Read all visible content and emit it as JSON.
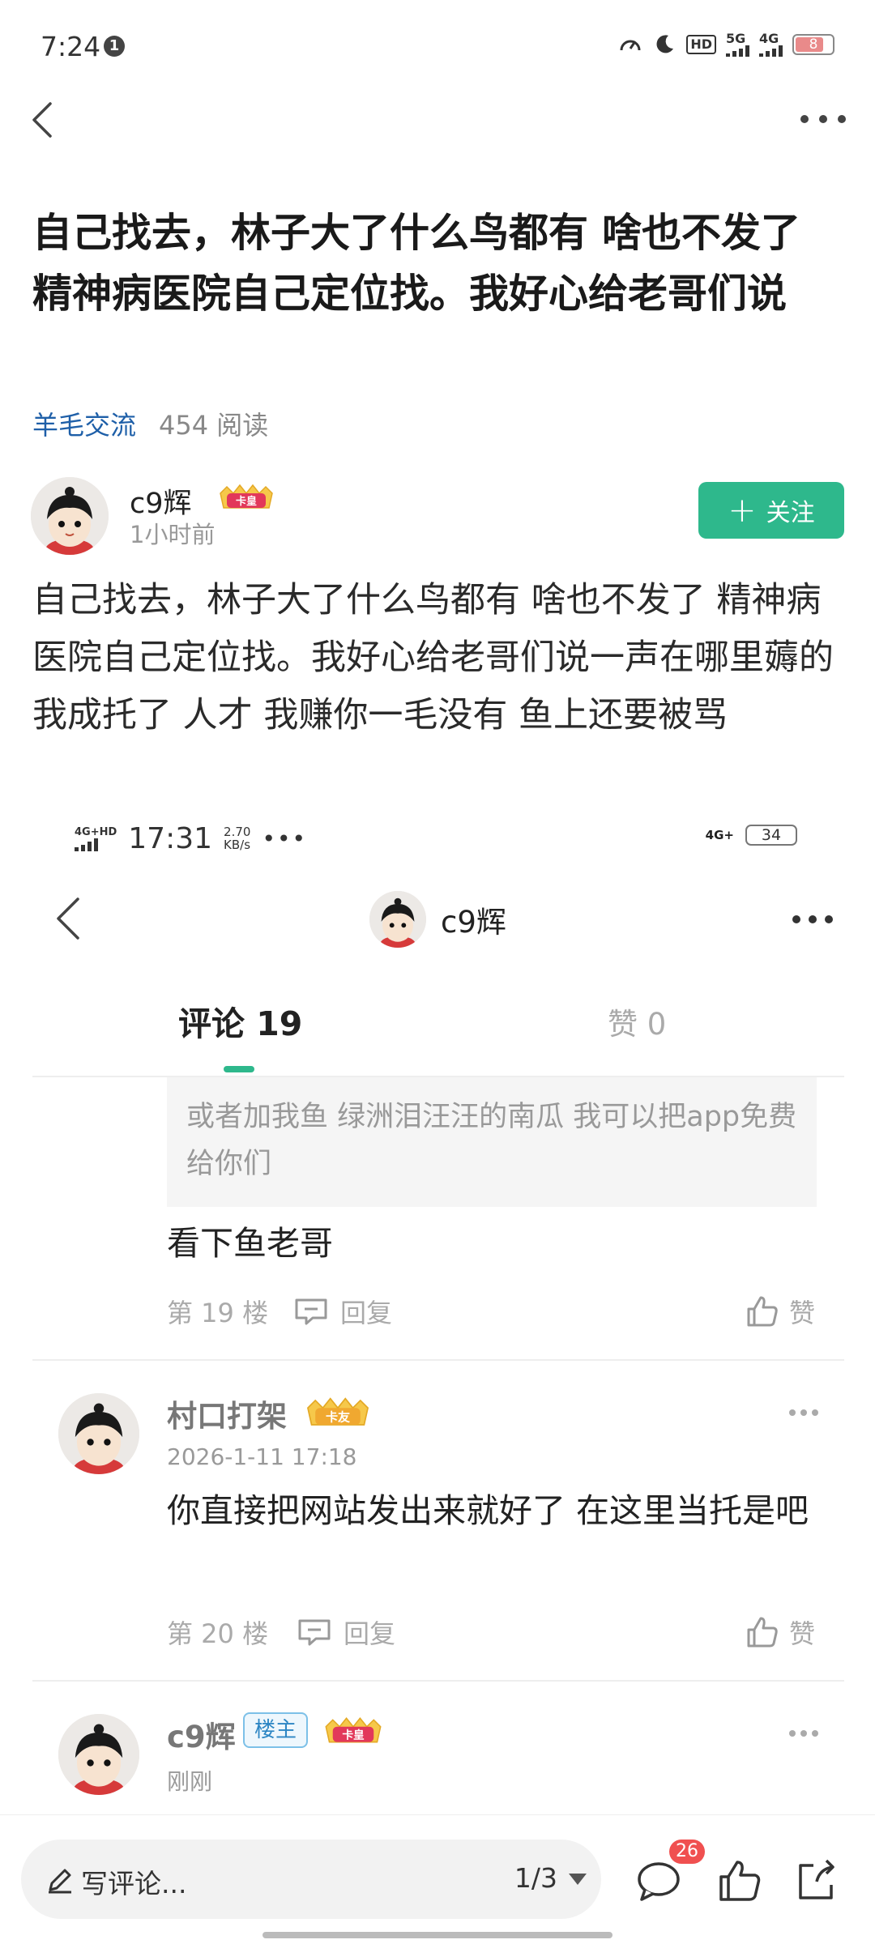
{
  "status_bar": {
    "time": "7:24",
    "notification_count": "1",
    "hd_label": "HD",
    "network_5g": "5G",
    "network_4g": "4G",
    "battery": "8"
  },
  "post": {
    "title": "自己找去，林子大了什么鸟都有 啥也不发了 精神病医院自己定位找。我好心给老哥们说",
    "category": "羊毛交流",
    "reads": "454 阅读",
    "author": {
      "name": "c9辉",
      "badge": "卡皇",
      "time": "1小时前"
    },
    "follow_label": "关注",
    "body": "自己找去，林子大了什么鸟都有  啥也不发了  精神病医院自己定位找。我好心给老哥们说一声在哪里薅的  我成托了  人才  我赚你一毛没有  鱼上还要被骂"
  },
  "embedded": {
    "status": {
      "network": "4G+HD",
      "time": "17:31",
      "speed_value": "2.70",
      "speed_unit": "KB/s",
      "dots": "•••",
      "network_right": "4G+",
      "battery": "34"
    },
    "header": {
      "title": "c9辉"
    },
    "tabs": {
      "comments": "评论 19",
      "likes": "赞 0"
    },
    "quote": "或者加我鱼   绿洲泪汪汪的南瓜  我可以把app免费给你们",
    "comments": [
      {
        "text": "看下鱼老哥",
        "floor": "第 19 楼",
        "reply": "回复",
        "like": "赞"
      },
      {
        "name": "村口打架",
        "badge": "卡友",
        "time": "2026-1-11 17:18",
        "text": "你直接把网站发出来就好了 在这里当托是吧",
        "floor": "第 20 楼",
        "reply": "回复",
        "like": "赞"
      },
      {
        "name": "c9辉",
        "host_badge": "楼主",
        "badge": "卡皇",
        "time": "刚刚"
      }
    ]
  },
  "bottom_bar": {
    "comment_placeholder": "写评论...",
    "page_indicator": "1/3",
    "comment_count_badge": "26"
  },
  "colors": {
    "accent_green": "#2eb88c",
    "category_blue": "#1e5fa8",
    "badge_red": "#f05050"
  }
}
